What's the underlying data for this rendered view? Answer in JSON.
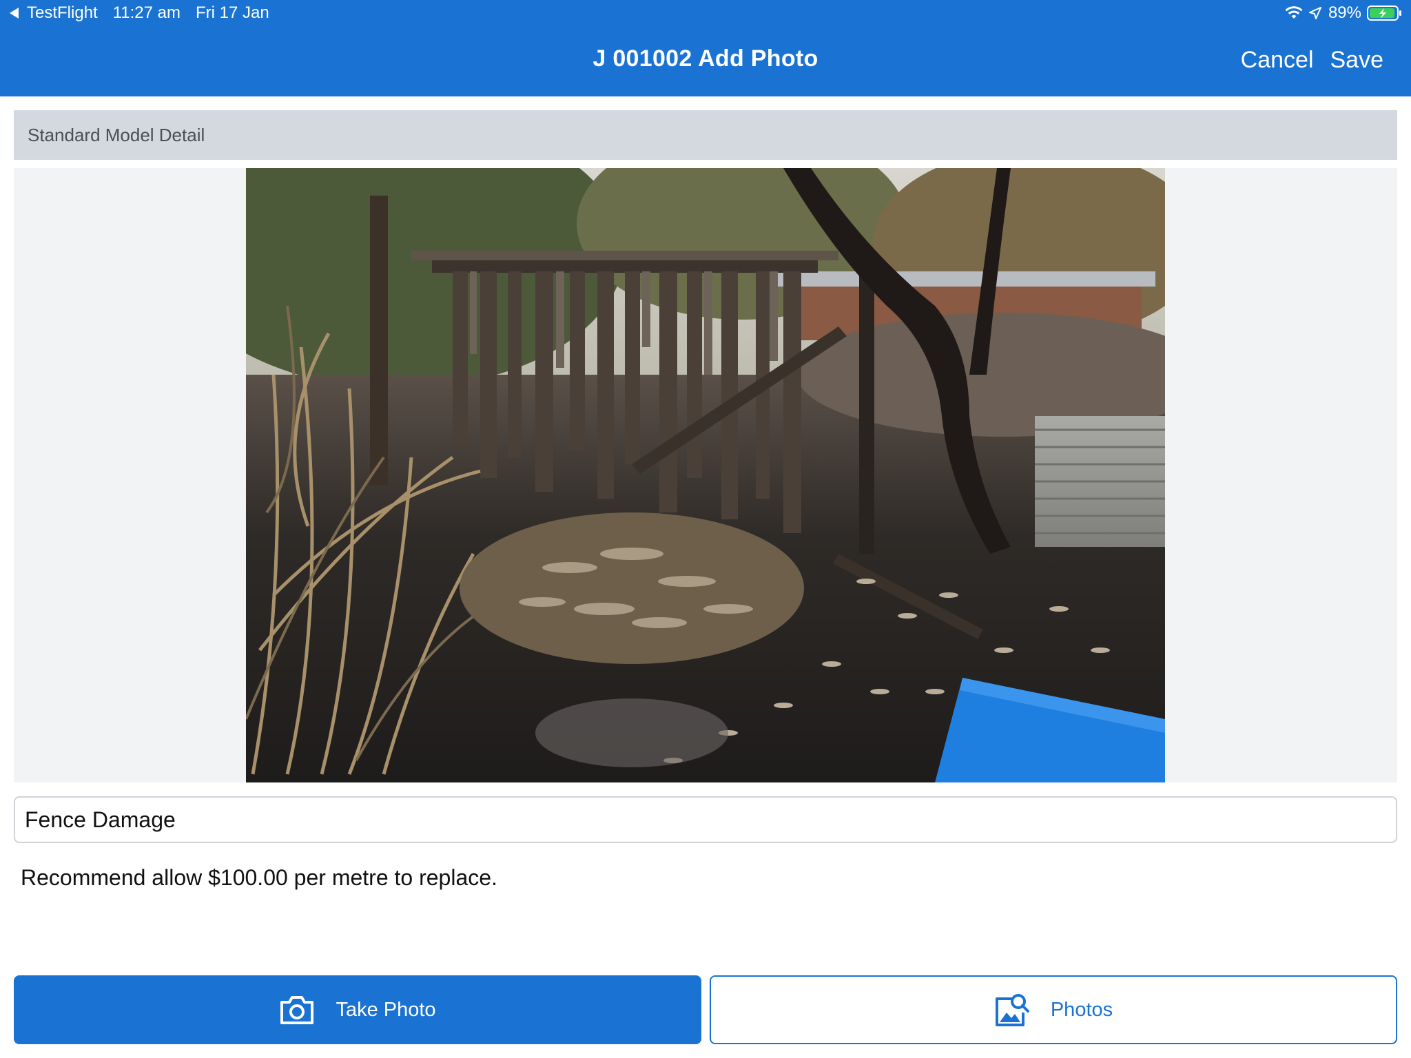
{
  "status_bar": {
    "back_app": "TestFlight",
    "time": "11:27 am",
    "date": "Fri 17 Jan",
    "battery": "89%",
    "icons": [
      "wifi-icon",
      "location-arrow-icon",
      "battery-charging-icon"
    ]
  },
  "nav": {
    "title": "J 001002 Add Photo",
    "cancel_label": "Cancel",
    "save_label": "Save"
  },
  "section": {
    "header": "Standard Model Detail"
  },
  "photo": {
    "description": "Photo of fire-damaged wooden fence"
  },
  "form": {
    "title_value": "Fence Damage",
    "notes_value": "Recommend allow $100.00 per metre to replace."
  },
  "buttons": {
    "take_photo_label": "Take Photo",
    "take_photo_icon": "camera-icon",
    "photos_label": "Photos",
    "photos_icon": "photo-search-icon"
  },
  "colors": {
    "accent": "#1a73d3",
    "section_bg": "#d3d9de",
    "photo_panel_bg": "#f1f3f5"
  }
}
